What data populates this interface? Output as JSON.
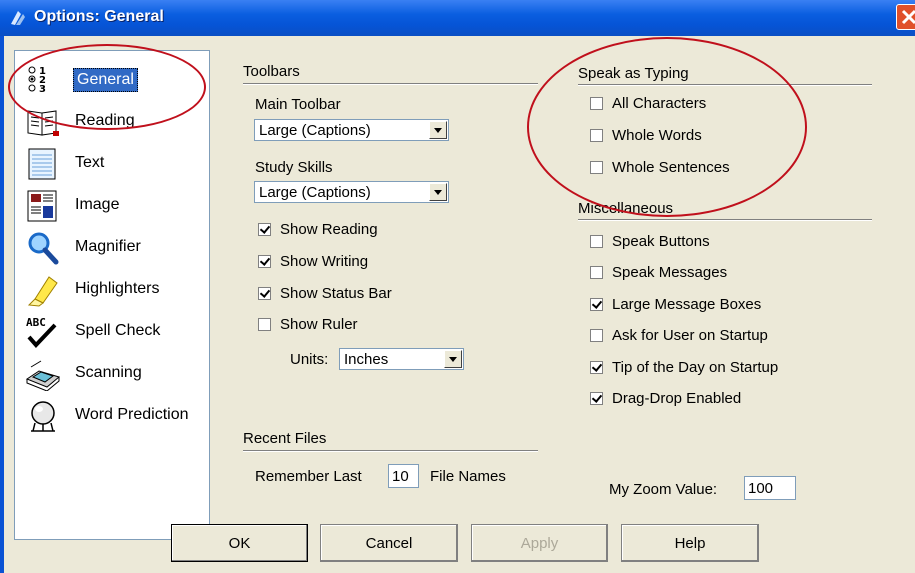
{
  "window": {
    "title": "Options: General"
  },
  "sidebar": {
    "items": [
      {
        "label": "General",
        "icon": "list-numbered-icon"
      },
      {
        "label": "Reading",
        "icon": "book-icon"
      },
      {
        "label": "Text",
        "icon": "document-text-icon"
      },
      {
        "label": "Image",
        "icon": "image-icon"
      },
      {
        "label": "Magnifier",
        "icon": "magnifier-icon"
      },
      {
        "label": "Highlighters",
        "icon": "highlighter-icon"
      },
      {
        "label": "Spell Check",
        "icon": "spell-check-icon"
      },
      {
        "label": "Scanning",
        "icon": "scanner-icon"
      },
      {
        "label": "Word Prediction",
        "icon": "crystal-ball-icon"
      }
    ]
  },
  "toolbars": {
    "title": "Toolbars",
    "main_toolbar_label": "Main Toolbar",
    "main_toolbar_value": "Large (Captions)",
    "study_skills_label": "Study Skills",
    "study_skills_value": "Large (Captions)",
    "show_reading": {
      "label": "Show Reading",
      "checked": true
    },
    "show_writing": {
      "label": "Show Writing",
      "checked": true
    },
    "show_status_bar": {
      "label": "Show Status Bar",
      "checked": true
    },
    "show_ruler": {
      "label": "Show Ruler",
      "checked": false
    },
    "units_label": "Units:",
    "units_value": "Inches"
  },
  "recent_files": {
    "title": "Recent Files",
    "remember_label": "Remember Last",
    "remember_value": "10",
    "file_names_label": "File Names"
  },
  "speak_as_typing": {
    "title": "Speak as Typing",
    "all_characters": {
      "label": "All Characters",
      "checked": false
    },
    "whole_words": {
      "label": "Whole Words",
      "checked": false
    },
    "whole_sentences": {
      "label": "Whole Sentences",
      "checked": false
    }
  },
  "miscellaneous": {
    "title": "Miscellaneous",
    "speak_buttons": {
      "label": "Speak Buttons",
      "checked": false
    },
    "speak_messages": {
      "label": "Speak Messages",
      "checked": false
    },
    "large_message_boxes": {
      "label": "Large Message Boxes",
      "checked": true
    },
    "ask_for_user": {
      "label": "Ask for User on Startup",
      "checked": false
    },
    "tip_of_the_day": {
      "label": "Tip of the Day on Startup",
      "checked": true
    },
    "drag_drop": {
      "label": "Drag-Drop Enabled",
      "checked": true
    }
  },
  "zoom": {
    "label": "My Zoom Value:",
    "value": "100"
  },
  "buttons": {
    "ok": "OK",
    "cancel": "Cancel",
    "apply": "Apply",
    "help": "Help"
  },
  "colors": {
    "titlebar": "#0a5ee0",
    "dialog_bg": "#ece9d8",
    "selection": "#316ac5",
    "annotation": "#c0101c"
  }
}
